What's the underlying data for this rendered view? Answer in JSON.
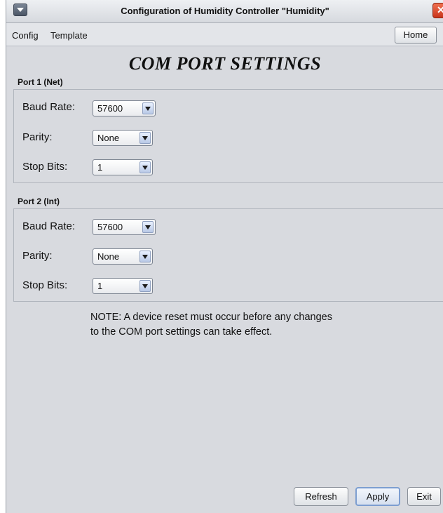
{
  "window": {
    "title": "Configuration of Humidity Controller \"Humidity\"",
    "close_glyph": "✕"
  },
  "menubar": {
    "items": [
      "Config",
      "Template"
    ],
    "home_label": "Home"
  },
  "page_title": "COM PORT SETTINGS",
  "ports": [
    {
      "title": "Port 1 (Net)",
      "fields": {
        "baud_label": "Baud Rate:",
        "baud_value": "57600",
        "parity_label": "Parity:",
        "parity_value": "None",
        "stop_label": "Stop Bits:",
        "stop_value": "1"
      }
    },
    {
      "title": "Port 2 (Int)",
      "fields": {
        "baud_label": "Baud Rate:",
        "baud_value": "57600",
        "parity_label": "Parity:",
        "parity_value": "None",
        "stop_label": "Stop Bits:",
        "stop_value": "1"
      }
    }
  ],
  "note": {
    "line1": "NOTE: A device reset must occur before any changes",
    "line2": "to the COM port settings can take effect."
  },
  "buttons": {
    "refresh": "Refresh",
    "apply": "Apply",
    "exit": "Exit"
  }
}
